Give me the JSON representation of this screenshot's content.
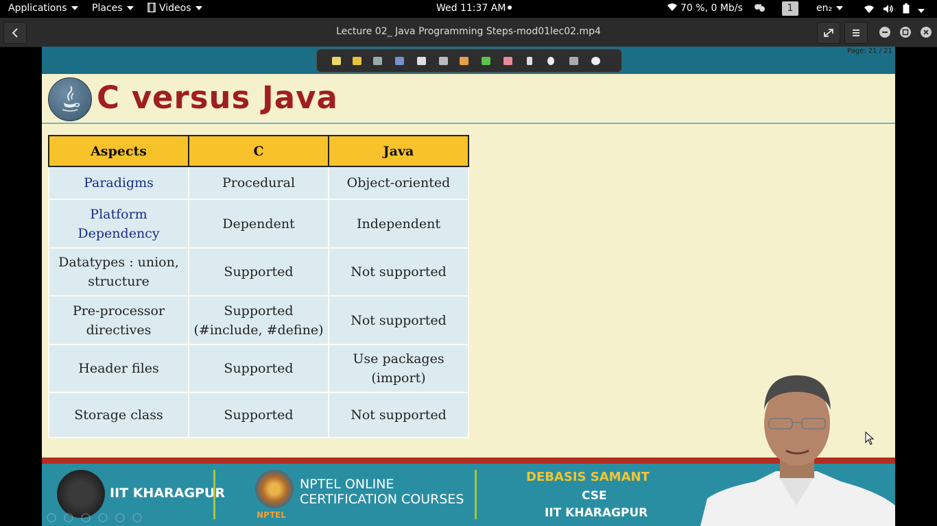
{
  "topbar": {
    "applications": "Applications",
    "places": "Places",
    "videos": "Videos",
    "clock": "Wed 11:37 AM",
    "network_status": "70 %, 0 Mb/s",
    "workspace": "1",
    "keyboard": "en₂"
  },
  "player": {
    "title": "Lecture 02_ Java Programming Steps-mod01lec02.mp4"
  },
  "slide": {
    "page_indicator": "Page: 21 / 21",
    "title": "C versus Java",
    "table": {
      "headers": [
        "Aspects",
        "C",
        "Java"
      ],
      "rows": [
        [
          "Paradigms",
          "Procedural",
          "Object-oriented"
        ],
        [
          "Platform Dependency",
          "Dependent",
          "Independent"
        ],
        [
          "Datatypes : union, structure",
          "Supported",
          "Not supported"
        ],
        [
          "Pre-processor directives",
          "Supported (#include, #define)",
          "Not supported"
        ],
        [
          "Header files",
          "Supported",
          "Use packages (import)"
        ],
        [
          "Storage class",
          "Supported",
          "Not supported"
        ]
      ]
    },
    "footer": {
      "institute": "IIT KHARAGPUR",
      "nptel_line1": "NPTEL ONLINE",
      "nptel_line2": "CERTIFICATION COURSES",
      "nptel_logo_text": "NPTEL",
      "presenter_name": "DEBASIS SAMANT",
      "presenter_dept": "CSE",
      "presenter_institute": "IIT KHARAGPUR"
    }
  },
  "colors": {
    "slide_background": "#f6f1cd",
    "header_cell": "#f7c22a",
    "body_cell": "#dcebef",
    "title_red": "#a11e1e",
    "footer_teal": "#2a8ea3",
    "footer_red_rule": "#b22d22"
  }
}
